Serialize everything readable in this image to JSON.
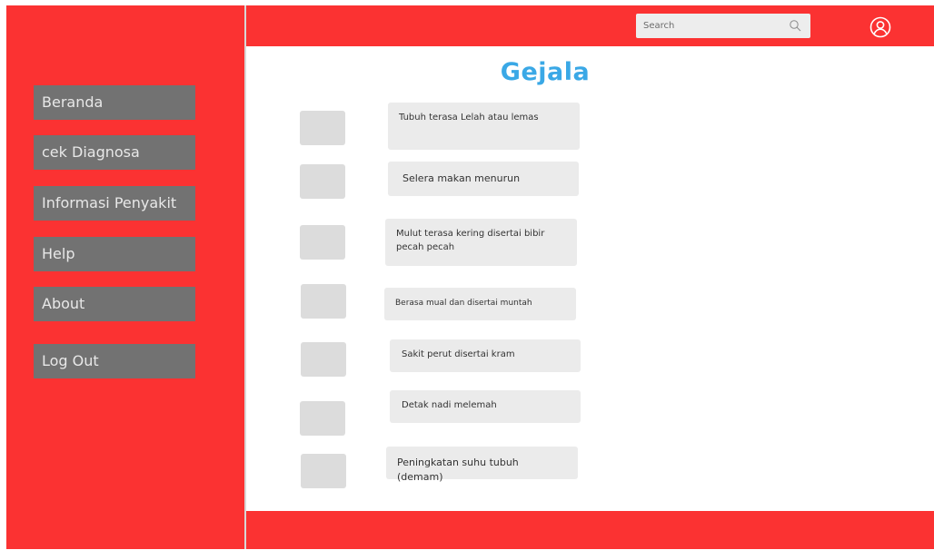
{
  "sidebar": {
    "items": [
      {
        "label": "Beranda"
      },
      {
        "label": "cek Diagnosa"
      },
      {
        "label": "Informasi Penyakit"
      },
      {
        "label": "Help"
      },
      {
        "label": "About"
      },
      {
        "label": "Log Out"
      }
    ]
  },
  "header": {
    "search": {
      "placeholder": "Search"
    }
  },
  "main": {
    "title": "Gejala",
    "symptoms": [
      {
        "label": "Tubuh terasa Lelah atau lemas"
      },
      {
        "label": "Selera  makan menurun"
      },
      {
        "label": "Mulut terasa kering disertai bibir pecah pecah"
      },
      {
        "label": "Berasa mual dan disertai muntah"
      },
      {
        "label": "Sakit perut disertai kram"
      },
      {
        "label": "Detak nadi melemah"
      },
      {
        "label": "Peningkatan suhu tubuh (demam)"
      }
    ]
  },
  "colors": {
    "accent": "#fb3232",
    "nav_button": "#727272",
    "title": "#3aa8e6",
    "checkbox": "#dcdcdc",
    "symptom_box": "#ebebeb"
  },
  "icons": {
    "search": "search-icon",
    "user": "user-icon"
  }
}
